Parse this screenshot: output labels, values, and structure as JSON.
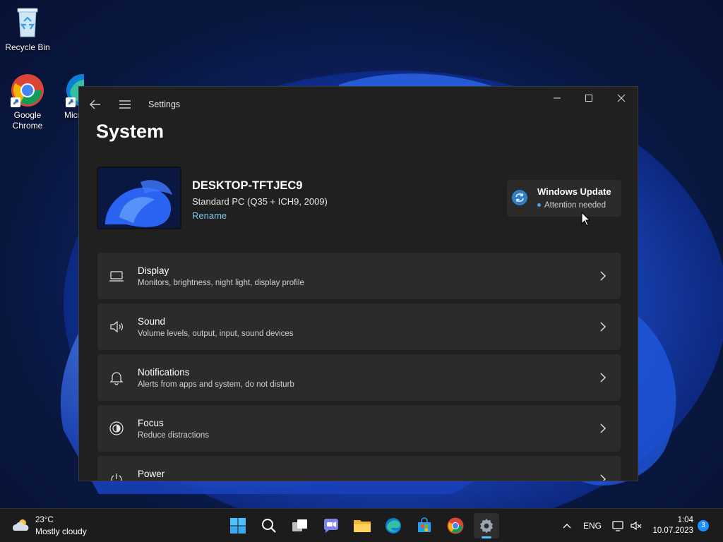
{
  "desktop": {
    "icons": [
      {
        "label": "Recycle Bin"
      },
      {
        "label": "Google Chrome"
      },
      {
        "label": "Micr... Ed..."
      }
    ]
  },
  "window": {
    "title": "Settings",
    "page_title": "System",
    "device": {
      "name": "DESKTOP-TFTJEC9",
      "model": "Standard PC (Q35 + ICH9, 2009)",
      "rename_label": "Rename"
    },
    "windows_update": {
      "title": "Windows Update",
      "status": "Attention needed"
    },
    "items": [
      {
        "title": "Display",
        "subtitle": "Monitors, brightness, night light, display profile",
        "icon": "laptop-icon"
      },
      {
        "title": "Sound",
        "subtitle": "Volume levels, output, input, sound devices",
        "icon": "speaker-icon"
      },
      {
        "title": "Notifications",
        "subtitle": "Alerts from apps and system, do not disturb",
        "icon": "bell-icon"
      },
      {
        "title": "Focus",
        "subtitle": "Reduce distractions",
        "icon": "focus-icon"
      },
      {
        "title": "Power",
        "subtitle": "",
        "icon": "power-icon"
      }
    ]
  },
  "taskbar": {
    "weather": {
      "temp": "23°C",
      "condition": "Mostly cloudy"
    },
    "apps": [
      "start-icon",
      "search-icon",
      "task-view-icon",
      "chat-icon",
      "file-explorer-icon",
      "edge-icon",
      "store-icon",
      "chrome-icon",
      "settings-icon"
    ],
    "tray": {
      "language": "ENG",
      "time": "1:04",
      "date": "10.07.2023",
      "notification_count": "3"
    }
  },
  "colors": {
    "accent": "#4cc2ff",
    "link": "#7cc7e8",
    "window_bg": "#202020",
    "card_bg": "#2b2b2b",
    "taskbar_bg": "#1c1c1c"
  }
}
